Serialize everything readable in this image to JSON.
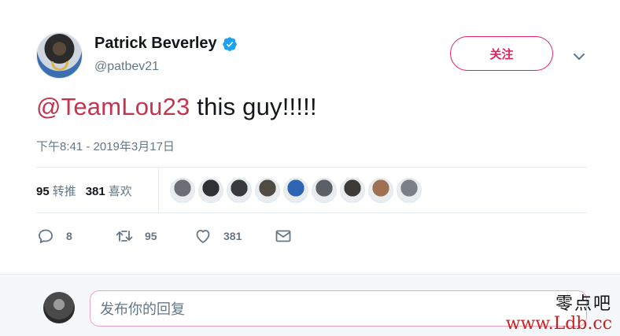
{
  "author": {
    "display_name": "Patrick Beverley",
    "handle": "@patbev21",
    "verified": true
  },
  "follow_button": {
    "label": "关注"
  },
  "tweet": {
    "mention": "@TeamLou23",
    "text": " this guy!!!!!",
    "timestamp": "下午8:41 - 2019年3月17日"
  },
  "stats": {
    "retweets_count": "95",
    "retweets_label": "转推",
    "likes_count": "381",
    "likes_label": "喜欢"
  },
  "likers": [
    "#6b6f75",
    "#2f3134",
    "#3a3a3a",
    "#514b45",
    "#2e66b3",
    "#5b5f66",
    "#3d3a38",
    "#a07052",
    "#7a7f86"
  ],
  "actions": {
    "reply_count": "8",
    "retweet_count": "95",
    "like_count": "381"
  },
  "reply": {
    "placeholder": "发布你的回复"
  },
  "watermark": {
    "line1": "零点吧",
    "line2": "www.Ldb.cc"
  },
  "colors": {
    "accent": "#e0245e",
    "mention": "#c5344e",
    "verified": "#1da1f2",
    "muted": "#657786"
  }
}
